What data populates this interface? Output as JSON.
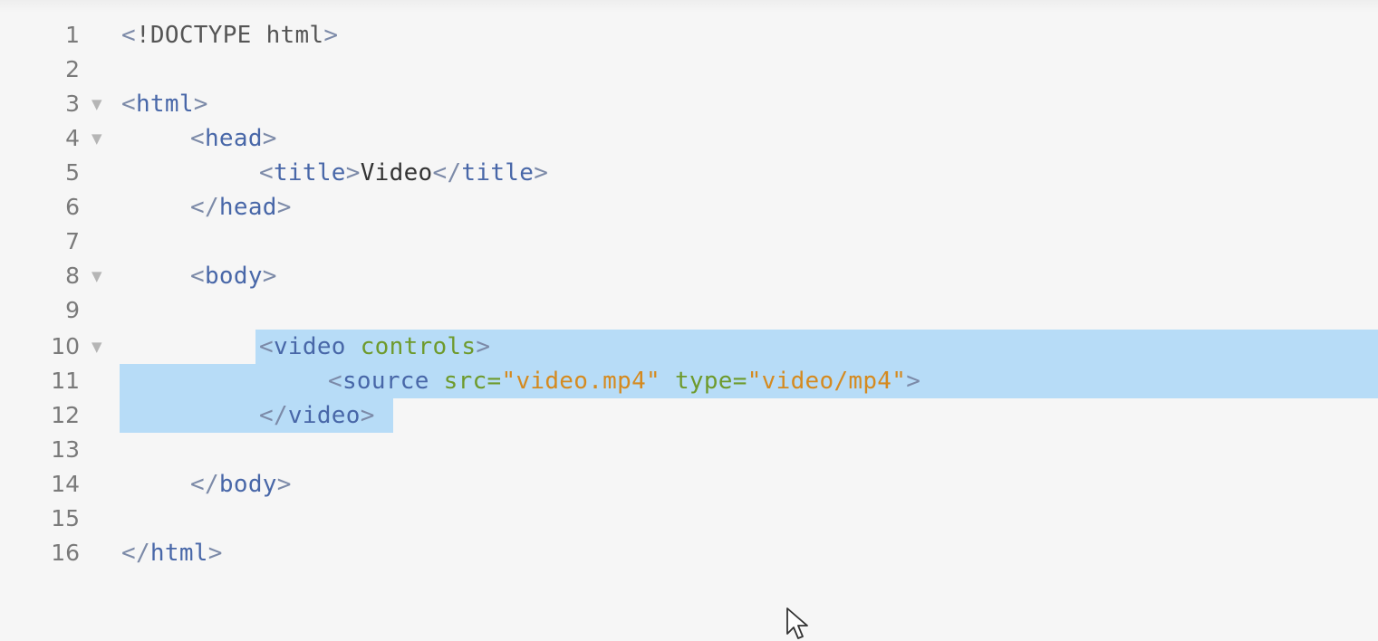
{
  "editor": {
    "lines": [
      {
        "num": "1",
        "text": "<!DOCTYPE html>"
      },
      {
        "num": "2",
        "text": ""
      },
      {
        "num": "3",
        "text": "<html>"
      },
      {
        "num": "4",
        "text": "<head>"
      },
      {
        "num": "5",
        "text": "<title>Video</title>"
      },
      {
        "num": "6",
        "text": "</head>"
      },
      {
        "num": "7",
        "text": ""
      },
      {
        "num": "8",
        "text": "<body>"
      },
      {
        "num": "9",
        "text": ""
      },
      {
        "num": "10",
        "text": "<video controls>"
      },
      {
        "num": "11",
        "text": "<source src=\"video.mp4\" type=\"video/mp4\">"
      },
      {
        "num": "12",
        "text": "</video>"
      },
      {
        "num": "13",
        "text": ""
      },
      {
        "num": "14",
        "text": "</body>"
      },
      {
        "num": "15",
        "text": ""
      },
      {
        "num": "16",
        "text": "</html>"
      }
    ],
    "tokens": {
      "lt": "<",
      "gt": ">",
      "lt_slash": "</",
      "doctype_bang": "!DOCTYPE",
      "doctype_html": " html",
      "html": "html",
      "head": "head",
      "title": "title",
      "title_text": "Video",
      "body": "body",
      "video": "video",
      "controls": " controls",
      "source": "source",
      "src_attr": " src=",
      "src_val": "\"video.mp4\"",
      "type_attr": " type=",
      "type_val": "\"video/mp4\""
    },
    "fold_marker": "▼",
    "colors": {
      "tag": "#4867a8",
      "attribute": "#6e9a2c",
      "string": "#d58a1f",
      "selection": "#b7dcf7",
      "line_number": "#7a7a7a"
    }
  }
}
